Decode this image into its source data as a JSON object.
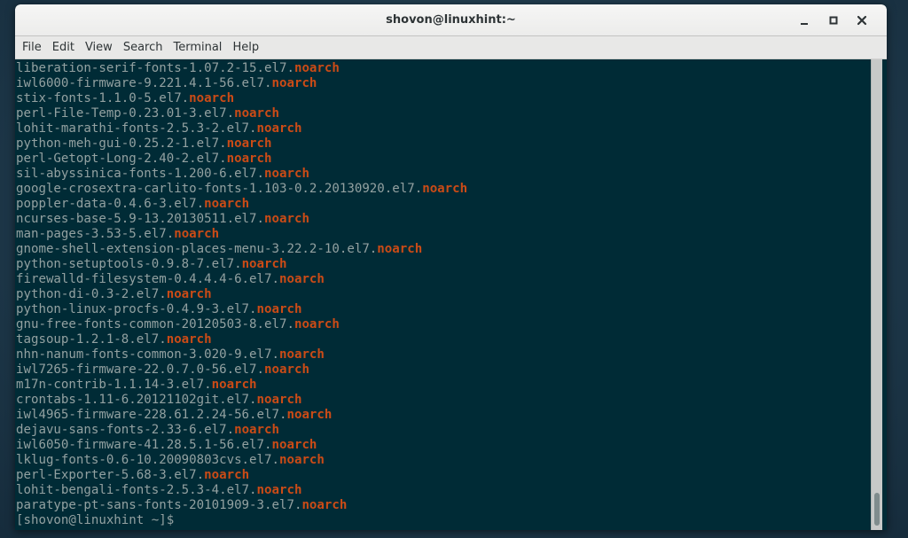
{
  "window": {
    "title": "shovon@linuxhint:~",
    "controls": {
      "minimize": "minimize-icon",
      "maximize": "maximize-icon",
      "close": "close-icon"
    }
  },
  "menubar": {
    "items": [
      "File",
      "Edit",
      "View",
      "Search",
      "Terminal",
      "Help"
    ]
  },
  "terminal": {
    "colors": {
      "background": "#002b36",
      "foreground": "#93a1a1",
      "arch_highlight": "#cb4b16"
    },
    "lines": [
      {
        "pkg": "liberation-serif-fonts-1.07.2-15.el7.",
        "arch": "noarch"
      },
      {
        "pkg": "iwl6000-firmware-9.221.4.1-56.el7.",
        "arch": "noarch"
      },
      {
        "pkg": "stix-fonts-1.1.0-5.el7.",
        "arch": "noarch"
      },
      {
        "pkg": "perl-File-Temp-0.23.01-3.el7.",
        "arch": "noarch"
      },
      {
        "pkg": "lohit-marathi-fonts-2.5.3-2.el7.",
        "arch": "noarch"
      },
      {
        "pkg": "python-meh-gui-0.25.2-1.el7.",
        "arch": "noarch"
      },
      {
        "pkg": "perl-Getopt-Long-2.40-2.el7.",
        "arch": "noarch"
      },
      {
        "pkg": "sil-abyssinica-fonts-1.200-6.el7.",
        "arch": "noarch"
      },
      {
        "pkg": "google-crosextra-carlito-fonts-1.103-0.2.20130920.el7.",
        "arch": "noarch"
      },
      {
        "pkg": "poppler-data-0.4.6-3.el7.",
        "arch": "noarch"
      },
      {
        "pkg": "ncurses-base-5.9-13.20130511.el7.",
        "arch": "noarch"
      },
      {
        "pkg": "man-pages-3.53-5.el7.",
        "arch": "noarch"
      },
      {
        "pkg": "gnome-shell-extension-places-menu-3.22.2-10.el7.",
        "arch": "noarch"
      },
      {
        "pkg": "python-setuptools-0.9.8-7.el7.",
        "arch": "noarch"
      },
      {
        "pkg": "firewalld-filesystem-0.4.4.4-6.el7.",
        "arch": "noarch"
      },
      {
        "pkg": "python-di-0.3-2.el7.",
        "arch": "noarch"
      },
      {
        "pkg": "python-linux-procfs-0.4.9-3.el7.",
        "arch": "noarch"
      },
      {
        "pkg": "gnu-free-fonts-common-20120503-8.el7.",
        "arch": "noarch"
      },
      {
        "pkg": "tagsoup-1.2.1-8.el7.",
        "arch": "noarch"
      },
      {
        "pkg": "nhn-nanum-fonts-common-3.020-9.el7.",
        "arch": "noarch"
      },
      {
        "pkg": "iwl7265-firmware-22.0.7.0-56.el7.",
        "arch": "noarch"
      },
      {
        "pkg": "m17n-contrib-1.1.14-3.el7.",
        "arch": "noarch"
      },
      {
        "pkg": "crontabs-1.11-6.20121102git.el7.",
        "arch": "noarch"
      },
      {
        "pkg": "iwl4965-firmware-228.61.2.24-56.el7.",
        "arch": "noarch"
      },
      {
        "pkg": "dejavu-sans-fonts-2.33-6.el7.",
        "arch": "noarch"
      },
      {
        "pkg": "iwl6050-firmware-41.28.5.1-56.el7.",
        "arch": "noarch"
      },
      {
        "pkg": "lklug-fonts-0.6-10.20090803cvs.el7.",
        "arch": "noarch"
      },
      {
        "pkg": "perl-Exporter-5.68-3.el7.",
        "arch": "noarch"
      },
      {
        "pkg": "lohit-bengali-fonts-2.5.3-4.el7.",
        "arch": "noarch"
      },
      {
        "pkg": "paratype-pt-sans-fonts-20101909-3.el7.",
        "arch": "noarch"
      }
    ],
    "prompt": "[shovon@linuxhint ~]$ "
  }
}
